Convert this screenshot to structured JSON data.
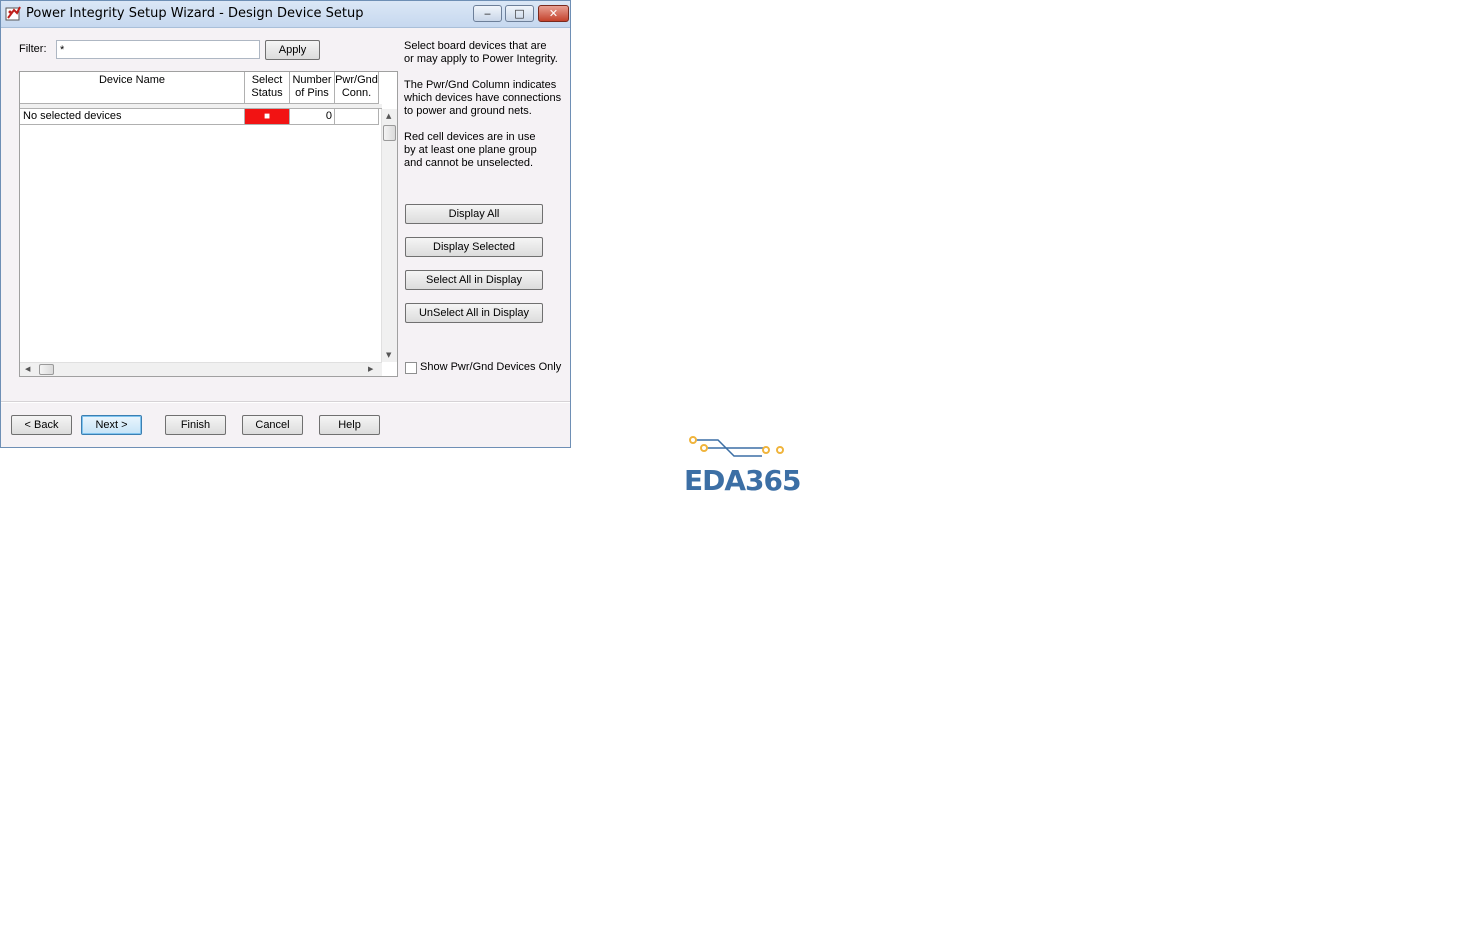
{
  "window": {
    "title": "Power Integrity Setup Wizard - Design Device Setup",
    "controls": {
      "minimize": "‒",
      "maximize": "□",
      "close": "✕"
    }
  },
  "filter": {
    "label": "Filter:",
    "value": "*",
    "apply_label": "Apply"
  },
  "grid": {
    "columns": [
      {
        "line1": "Device Name",
        "line2": ""
      },
      {
        "line1": "Select",
        "line2": "Status"
      },
      {
        "line1": "Number",
        "line2": "of Pins"
      },
      {
        "line1": "Pwr/Gnd",
        "line2": "Conn."
      }
    ],
    "rows": [
      {
        "device_name": "No selected devices",
        "select_status": "■",
        "num_pins": "0",
        "pwr_gnd": ""
      }
    ]
  },
  "help_text": {
    "p1_line1": "Select board devices that are",
    "p1_line2": "or may apply to Power Integrity.",
    "p2_line1": "The Pwr/Gnd Column indicates",
    "p2_line2": "which devices have connections",
    "p2_line3": "to power and ground nets.",
    "p3_line1": "Red cell devices are in use",
    "p3_line2": "by at least one plane group",
    "p3_line3": "and cannot be unselected."
  },
  "actions": {
    "display_all": "Display All",
    "display_selected": "Display Selected",
    "select_all": "Select All in Display",
    "unselect_all": "UnSelect All in Display"
  },
  "show_pwr_gnd_only": {
    "label": "Show Pwr/Gnd Devices Only",
    "checked": false
  },
  "footer": {
    "back": "< Back",
    "next": "Next >",
    "finish": "Finish",
    "cancel": "Cancel",
    "help": "Help"
  },
  "watermark": {
    "text": "EDA365"
  },
  "colors": {
    "red_cell": "#f21313",
    "logo_blue": "#3c6fa5",
    "logo_orange": "#f0b43c"
  }
}
